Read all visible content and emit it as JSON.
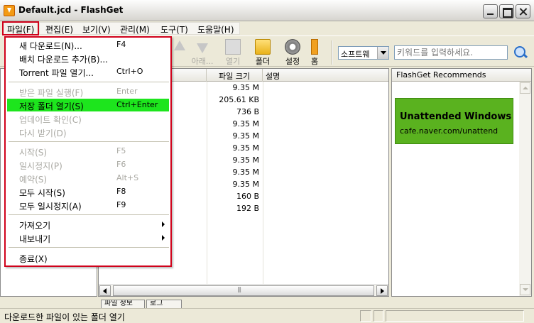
{
  "window": {
    "title": "Default.jcd - FlashGet"
  },
  "menubar": [
    {
      "label": "파일(F)"
    },
    {
      "label": "편집(E)"
    },
    {
      "label": "보기(V)"
    },
    {
      "label": "관리(M)"
    },
    {
      "label": "도구(T)"
    },
    {
      "label": "도움말(H)"
    }
  ],
  "toolbar": {
    "buttons": [
      {
        "label": "",
        "icon": "arrow-up-icon"
      },
      {
        "label": "아래...",
        "icon": "arrow-down-icon"
      },
      {
        "label": "열기",
        "icon": "open-icon"
      },
      {
        "label": "폴더",
        "icon": "folder-icon"
      },
      {
        "label": "설정",
        "icon": "gear-icon"
      },
      {
        "label": "홈",
        "icon": "home-icon"
      }
    ],
    "category_select": "소프트웨",
    "search_placeholder": "키워드를 입력하세요."
  },
  "file_list": {
    "columns": [
      "파일 크기",
      "설명"
    ],
    "sizes": [
      "9.35 M",
      "205.61 KB",
      "736 B",
      "9.35 M",
      "9.35 M",
      "9.35 M",
      "9.35 M",
      "9.35 M",
      "9.35 M",
      "160 B",
      "192 B"
    ]
  },
  "recommend": {
    "header": "FlashGet Recommends",
    "ad_title": "Unattended Windows",
    "ad_url": "cafe.naver.com/unattend",
    "ad_color": "#5ab21f"
  },
  "bottom_tabs": [
    "파일 정보",
    "로그"
  ],
  "status": {
    "text": "다운로드한 파일이 있는 폴더 열기"
  },
  "file_menu": {
    "group1": [
      {
        "label": "새 다운로드(N)...",
        "shortcut": "F4",
        "enabled": true
      },
      {
        "label": "배치 다운로드 추가(B)...",
        "shortcut": "",
        "enabled": true
      },
      {
        "label": "Torrent 파일 열기...",
        "shortcut": "Ctrl+O",
        "enabled": true
      }
    ],
    "group2": [
      {
        "label": "받은 파일 실행(F)",
        "shortcut": "Enter",
        "enabled": false
      },
      {
        "label": "저장 폴더 열기(S)",
        "shortcut": "Ctrl+Enter",
        "enabled": true,
        "highlighted": true
      },
      {
        "label": "업데이트 확인(C)",
        "shortcut": "",
        "enabled": false
      },
      {
        "label": "다시 받기(D)",
        "shortcut": "",
        "enabled": false
      }
    ],
    "group3": [
      {
        "label": "시작(S)",
        "shortcut": "F5",
        "enabled": false
      },
      {
        "label": "일시정지(P)",
        "shortcut": "F6",
        "enabled": false
      },
      {
        "label": "예약(S)",
        "shortcut": "Alt+S",
        "enabled": false
      },
      {
        "label": "모두 시작(S)",
        "shortcut": "F8",
        "enabled": true
      },
      {
        "label": "모두 일시정지(A)",
        "shortcut": "F9",
        "enabled": true
      }
    ],
    "group4": [
      {
        "label": "가져오기"
      },
      {
        "label": "내보내기"
      }
    ],
    "group5": [
      {
        "label": "종료(X)"
      }
    ],
    "highlight_color": "#1de51d"
  }
}
